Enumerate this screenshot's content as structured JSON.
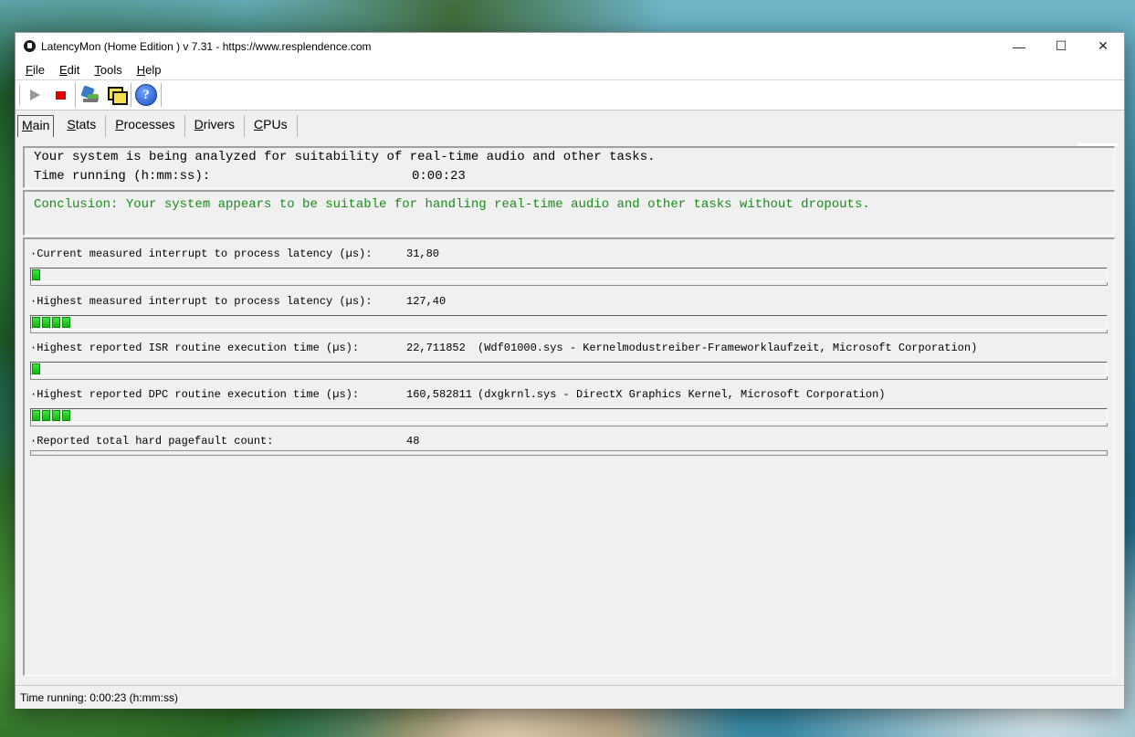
{
  "window": {
    "title": "LatencyMon  (Home Edition )  v 7.31 - https://www.resplendence.com",
    "controls": {
      "minimize": "—",
      "maximize": "☐",
      "close": "✕"
    }
  },
  "menu": [
    {
      "key": "F",
      "rest": "ile"
    },
    {
      "key": "E",
      "rest": "dit"
    },
    {
      "key": "T",
      "rest": "ools"
    },
    {
      "key": "H",
      "rest": "elp"
    }
  ],
  "toolbar": {
    "icons": [
      "play-icon",
      "stop-icon",
      "tools-icon",
      "windows-icon",
      "help-icon"
    ],
    "help_glyph": "?"
  },
  "tabs": [
    {
      "key": "M",
      "rest": "ain",
      "active": true
    },
    {
      "key": "S",
      "rest": "tats",
      "active": false
    },
    {
      "key": "P",
      "rest": "rocesses",
      "active": false
    },
    {
      "key": "D",
      "rest": "rivers",
      "active": false
    },
    {
      "key": "C",
      "rest": "PUs",
      "active": false
    }
  ],
  "status_panel": {
    "analyzing": "Your system is being analyzed for suitability of real-time audio and other tasks.",
    "time_label": "Time running (h:mm:ss):",
    "time_value": "0:00:23"
  },
  "conclusion": "Conclusion: Your system appears to be suitable for handling real-time audio and other tasks without dropouts.",
  "metrics": [
    {
      "label": "·Current measured interrupt to process latency (µs):",
      "value": "31,80",
      "extra": "",
      "bar_segments": 1
    },
    {
      "label": "·Highest measured interrupt to process latency (µs):",
      "value": "127,40",
      "extra": "",
      "bar_segments": 4
    },
    {
      "label": "·Highest reported ISR routine execution time (µs):",
      "value": "22,711852",
      "extra": "(Wdf01000.sys - Kernelmodustreiber-Frameworklaufzeit, Microsoft Corporation)",
      "bar_segments": 1
    },
    {
      "label": "·Highest reported DPC routine execution time (µs):",
      "value": "160,582811",
      "extra": "(dxgkrnl.sys - DirectX Graphics Kernel, Microsoft Corporation)",
      "bar_segments": 4
    },
    {
      "label": "·Reported total hard pagefault count:",
      "value": "48",
      "extra": "",
      "bar_segments": 0
    }
  ],
  "statusbar": "Time running: 0:00:23  (h:mm:ss)",
  "colors": {
    "bar_green": "#1ecf1e",
    "conclusion_green": "#1a8a1a",
    "stop_red": "#e00000"
  }
}
